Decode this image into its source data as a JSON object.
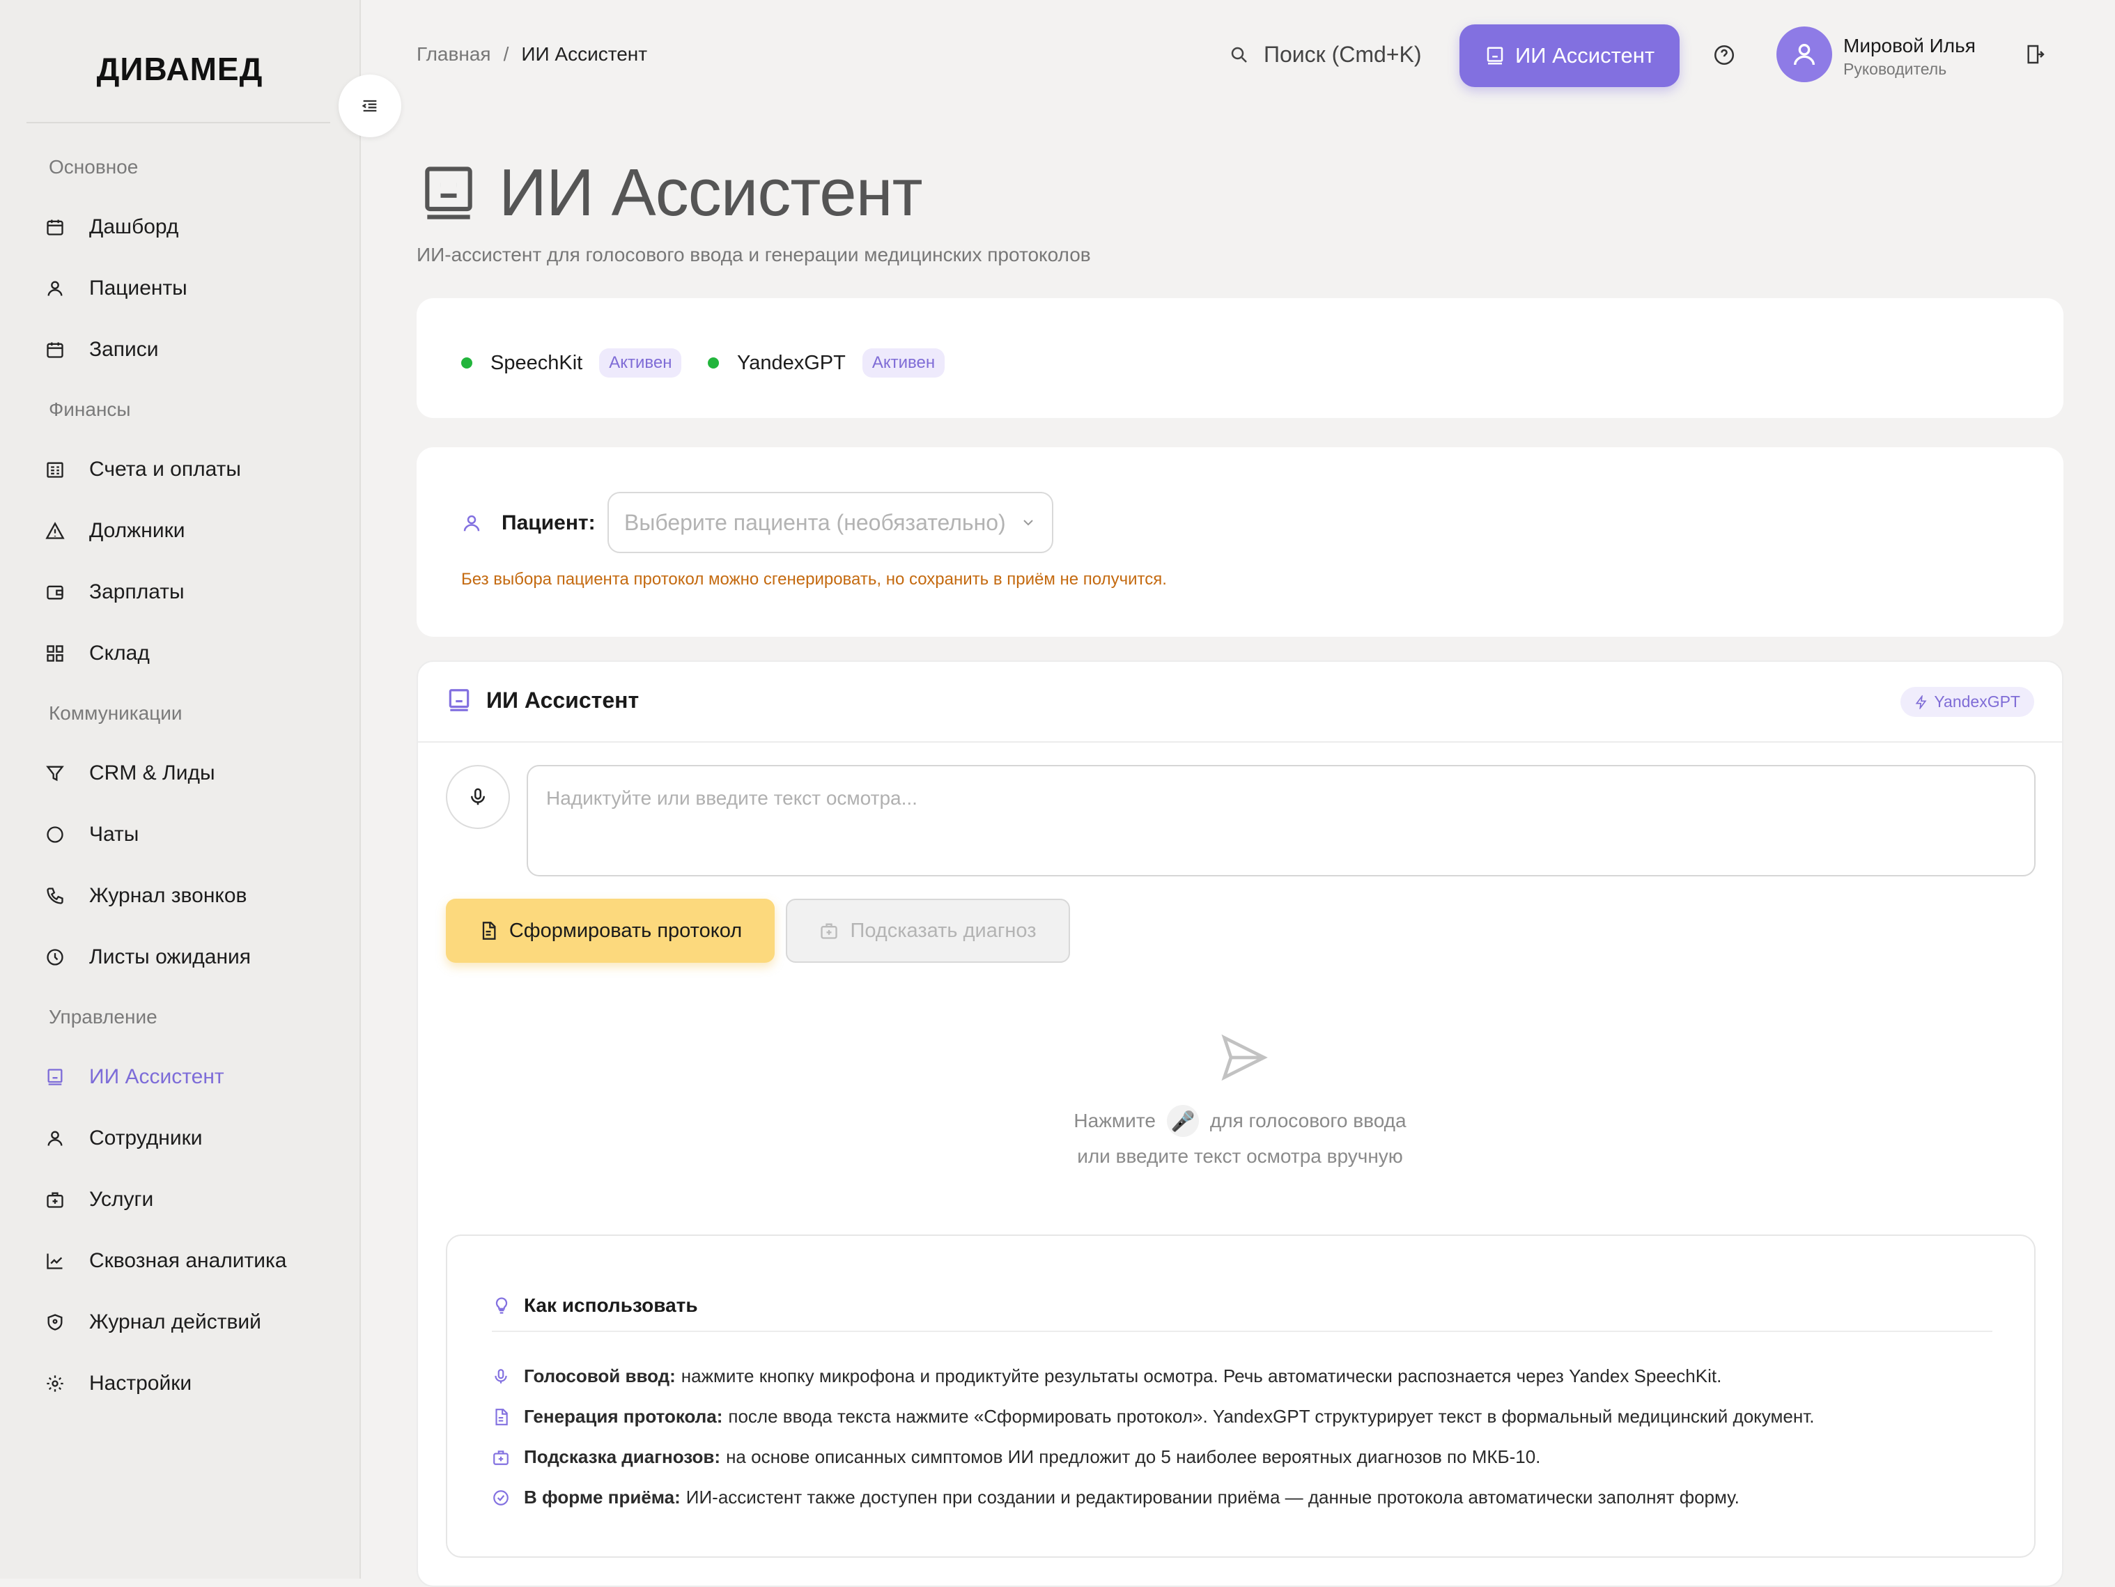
{
  "sidebar": {
    "logo": "ДИВАМЕД",
    "sections": [
      {
        "title": "Основное",
        "items": [
          {
            "label": "Дашборд",
            "icon": "calendar-icon"
          },
          {
            "label": "Пациенты",
            "icon": "user-icon"
          },
          {
            "label": "Записи",
            "icon": "calendar-icon"
          }
        ]
      },
      {
        "title": "Финансы",
        "items": [
          {
            "label": "Счета и оплаты",
            "icon": "receipt-icon"
          },
          {
            "label": "Должники",
            "icon": "warning-icon"
          },
          {
            "label": "Зарплаты",
            "icon": "wallet-icon"
          },
          {
            "label": "Склад",
            "icon": "grid-icon"
          }
        ]
      },
      {
        "title": "Коммуникации",
        "items": [
          {
            "label": "CRM & Лиды",
            "icon": "funnel-icon"
          },
          {
            "label": "Чаты",
            "icon": "chat-icon"
          },
          {
            "label": "Журнал звонков",
            "icon": "phone-icon"
          },
          {
            "label": "Листы ожидания",
            "icon": "clock-icon"
          }
        ]
      },
      {
        "title": "Управление",
        "items": [
          {
            "label": "ИИ Ассистент",
            "icon": "robot-icon",
            "active": true
          },
          {
            "label": "Сотрудники",
            "icon": "user-icon"
          },
          {
            "label": "Услуги",
            "icon": "medkit-icon"
          },
          {
            "label": "Сквозная аналитика",
            "icon": "chart-icon"
          },
          {
            "label": "Журнал действий",
            "icon": "shield-icon"
          },
          {
            "label": "Настройки",
            "icon": "gear-icon"
          }
        ]
      }
    ]
  },
  "header": {
    "breadcrumb_home": "Главная",
    "breadcrumb_sep": "/",
    "breadcrumb_current": "ИИ Ассистент",
    "search_label": "Поиск (Cmd+K)",
    "ai_button": "ИИ Ассистент",
    "user_name": "Мировой Илья",
    "user_role": "Руководитель"
  },
  "page": {
    "title": "ИИ Ассистент",
    "subtitle": "ИИ-ассистент для голосового ввода и генерации медицинских протоколов"
  },
  "services": [
    {
      "name": "SpeechKit",
      "status": "Активен"
    },
    {
      "name": "YandexGPT",
      "status": "Активен"
    }
  ],
  "patient": {
    "label": "Пациент:",
    "placeholder": "Выберите пациента (необязательно)",
    "warning": "Без выбора пациента протокол можно сгенерировать, но сохранить в приём не получится."
  },
  "assistant": {
    "title": "ИИ Ассистент",
    "engine_tag": "YandexGPT",
    "input_placeholder": "Надиктуйте или введите текст осмотра...",
    "generate_button": "Сформировать протокол",
    "diagnosis_button": "Подсказать диагноз",
    "empty_pre": "Нажмите",
    "empty_post": "для голосового ввода",
    "empty_line2": "или введите текст осмотра вручную",
    "mic_emoji": "🎤"
  },
  "howto": {
    "title": "Как использовать",
    "tips": [
      {
        "bold": "Голосовой ввод:",
        "text": "нажмите кнопку микрофона и продиктуйте результаты осмотра. Речь автоматически распознается через Yandex SpeechKit."
      },
      {
        "bold": "Генерация протокола:",
        "text": "после ввода текста нажмите «Сформировать протокол». YandexGPT структурирует текст в формальный медицинский документ."
      },
      {
        "bold": "Подсказка диагнозов:",
        "text": "на основе описанных симптомов ИИ предложит до 5 наиболее вероятных диагнозов по МКБ-10."
      },
      {
        "bold": "В форме приёма:",
        "text": "ИИ-ассистент также доступен при создании и редактировании приёма — данные протокола автоматически заполнят форму."
      }
    ]
  },
  "colors": {
    "accent": "#8270e0",
    "active_nav": "#7d6cd8",
    "status_dot": "#22b53c",
    "warning": "#c46a10",
    "generate_button": "#fcd97d"
  }
}
